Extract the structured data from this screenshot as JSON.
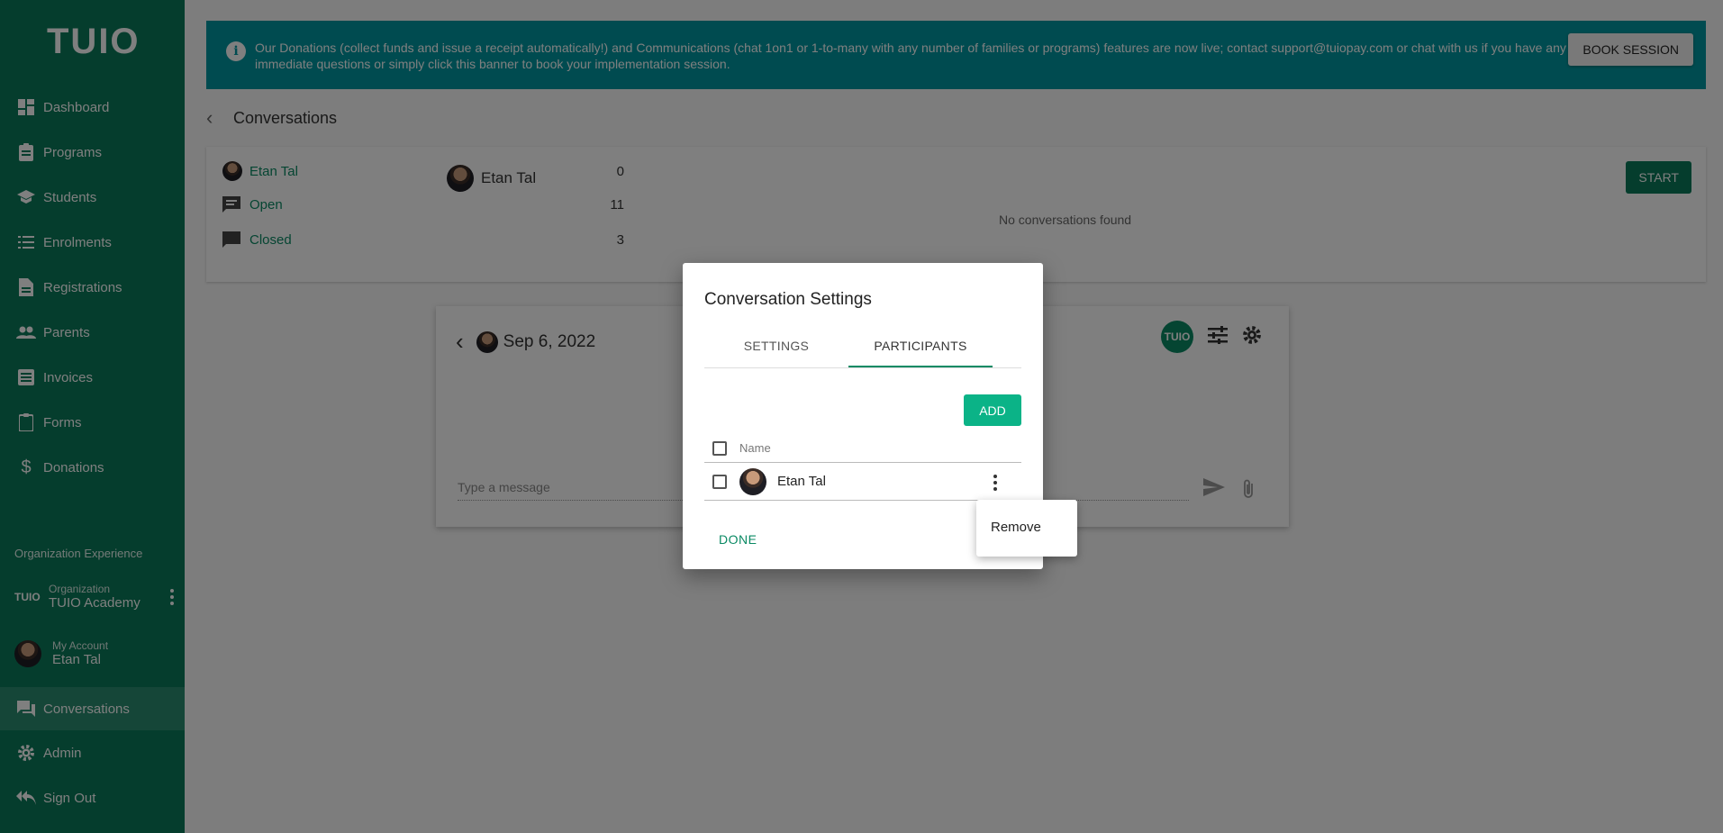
{
  "sidebar": {
    "logo": "TUIO",
    "items": [
      {
        "label": "Dashboard",
        "icon": "dashboard-icon"
      },
      {
        "label": "Programs",
        "icon": "clipboard-icon"
      },
      {
        "label": "Students",
        "icon": "school-icon"
      },
      {
        "label": "Enrolments",
        "icon": "list-icon"
      },
      {
        "label": "Registrations",
        "icon": "document-icon"
      },
      {
        "label": "Parents",
        "icon": "people-icon"
      },
      {
        "label": "Invoices",
        "icon": "invoice-icon"
      },
      {
        "label": "Forms",
        "icon": "clipboard-icon"
      },
      {
        "label": "Donations",
        "icon": "dollar-icon"
      }
    ],
    "section_label": "Organization Experience",
    "organization": {
      "badge": "TUIO",
      "sub": "Organization",
      "name": "TUIO Academy"
    },
    "account": {
      "sub": "My Account",
      "name": "Etan Tal"
    },
    "bottom_items": [
      {
        "label": "Conversations",
        "icon": "chat-icon",
        "active": true
      },
      {
        "label": "Admin",
        "icon": "gear-icon"
      },
      {
        "label": "Sign Out",
        "icon": "reply-all-icon"
      }
    ]
  },
  "banner": {
    "text": "Our Donations (collect funds and issue a receipt automatically!) and Communications (chat 1on1 or 1-to-many with any number of families or programs) features are now live; contact support@tuiopay.com or chat with us if you have any immediate questions or simply click this banner to book your implementation session.",
    "button": "BOOK SESSION"
  },
  "page": {
    "title": "Conversations"
  },
  "conversations": {
    "filters": [
      {
        "label": "Etan Tal",
        "count": "0"
      },
      {
        "label": "Open",
        "count": "11"
      },
      {
        "label": "Closed",
        "count": "3"
      }
    ],
    "selected_name": "Etan Tal",
    "empty_text": "No conversations found",
    "start_button": "START"
  },
  "chat": {
    "date": "Sep 6, 2022",
    "badge": "TUIO",
    "message_placeholder": "Type a message"
  },
  "dialog": {
    "title": "Conversation Settings",
    "tabs": [
      {
        "label": "SETTINGS",
        "active": false
      },
      {
        "label": "PARTICIPANTS",
        "active": true
      }
    ],
    "add_button": "ADD",
    "column_name": "Name",
    "participants": [
      {
        "name": "Etan Tal"
      }
    ],
    "done_button": "DONE"
  },
  "context_menu": {
    "items": [
      "Remove"
    ]
  },
  "colors": {
    "sidebar": "#0b7a5a",
    "banner": "#0097a0",
    "accent": "#0bb387"
  }
}
